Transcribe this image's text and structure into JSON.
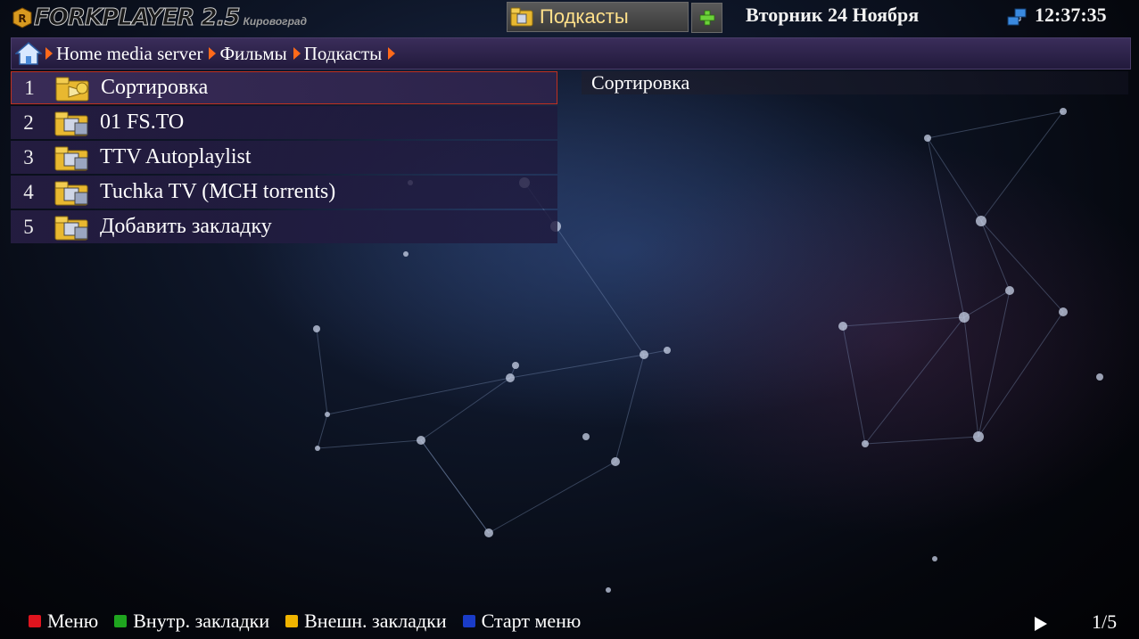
{
  "header": {
    "logo_text": "FORKPLAYER 2.5",
    "logo_city": "Кировоград",
    "current_folder": "Подкасты",
    "date": "Вторник 24 Ноября",
    "time": "12:37:35"
  },
  "breadcrumb": {
    "items": [
      "Home media server",
      "Фильмы",
      "Подкасты"
    ]
  },
  "list": {
    "items": [
      {
        "num": "1",
        "title": "Сортировка",
        "icon": "sort-folder-icon",
        "selected": true
      },
      {
        "num": "2",
        "title": "01 FS.TO",
        "icon": "folder-icon"
      },
      {
        "num": "3",
        "title": "TTV Autoplaylist",
        "icon": "folder-icon"
      },
      {
        "num": "4",
        "title": "Tuchka TV (MCH torrents)",
        "icon": "folder-icon"
      },
      {
        "num": "5",
        "title": "Добавить закладку",
        "icon": "folder-icon"
      }
    ]
  },
  "info_panel": {
    "title": "Сортировка"
  },
  "footer": {
    "legend": [
      {
        "label": "Меню",
        "color": "#e0141e"
      },
      {
        "label": "Внутр. закладки",
        "color": "#1fa51f"
      },
      {
        "label": "Внешн. закладки",
        "color": "#f0b400"
      },
      {
        "label": "Старт меню",
        "color": "#1a3cc8"
      }
    ],
    "page": "1/5"
  },
  "colors": {
    "accent_arrow": "#ff6a1a",
    "selection_border": "#c0301e",
    "folder_label": "#ffe08a"
  }
}
